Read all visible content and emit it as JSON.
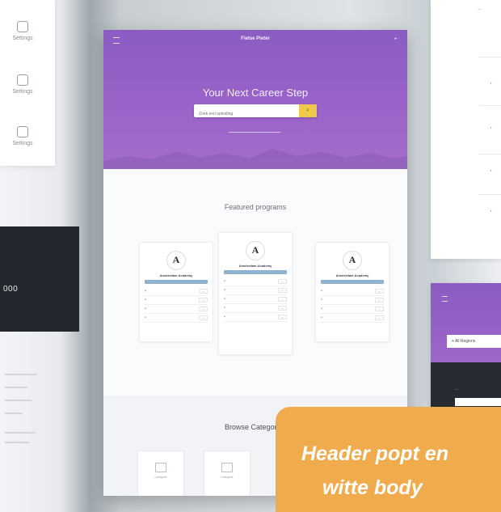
{
  "left_panel": {
    "items": [
      {
        "icon": "gear-icon",
        "label": "Settings"
      },
      {
        "icon": "gear-icon",
        "label": "Settings"
      },
      {
        "icon": "gear-icon",
        "label": "Settings"
      }
    ],
    "dark_big": "000"
  },
  "hero": {
    "logo": "Fietse Pieter",
    "title": "Your Next Career Step",
    "search_placeholder": "Zoek een opleiding",
    "search_icon": "search-icon"
  },
  "featured": {
    "title": "Featured programs",
    "cards": [
      {
        "name": "Amsterdam Academy"
      },
      {
        "name": "Amsterdam Academy"
      },
      {
        "name": "Amsterdam Academy"
      }
    ]
  },
  "browse": {
    "title": "Browse Categories",
    "categories": [
      {
        "label": "Categorie"
      },
      {
        "label": "Categorie"
      }
    ]
  },
  "right_bottom": {
    "field": "All Regions"
  },
  "caption": {
    "line1": "Header popt en",
    "line2": "witte body"
  },
  "colors": {
    "accent_purple": "#9a63c9",
    "search_button": "#f1c94a",
    "caption_bg": "#f0ab4c"
  }
}
